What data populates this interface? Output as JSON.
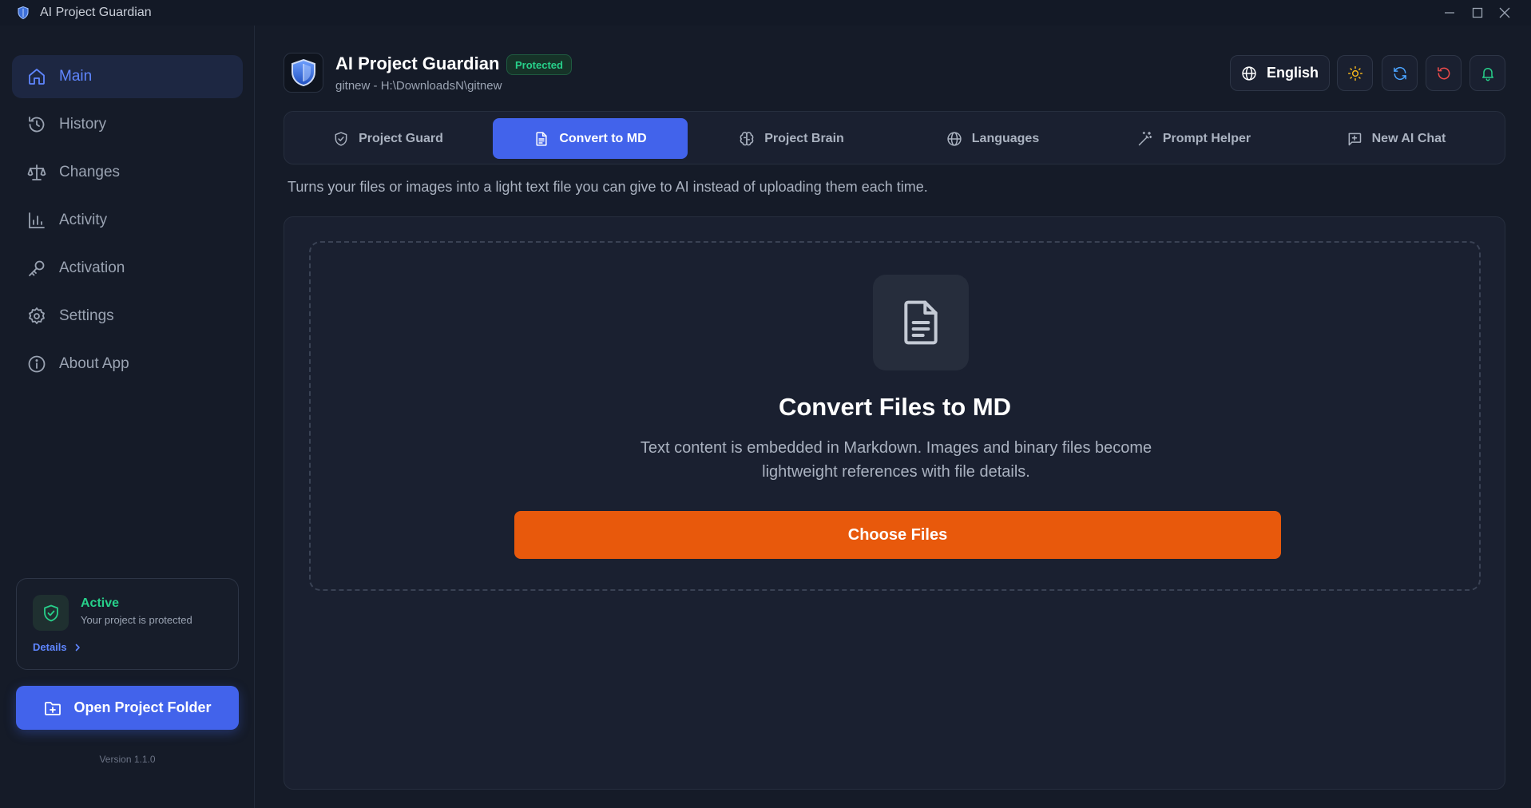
{
  "window": {
    "title": "AI Project Guardian",
    "controls": [
      "minimize-icon",
      "maximize-icon",
      "close-icon"
    ]
  },
  "sidebar": {
    "items": [
      {
        "label": "Main",
        "icon": "home-icon",
        "active": true
      },
      {
        "label": "History",
        "icon": "history-icon",
        "active": false
      },
      {
        "label": "Changes",
        "icon": "scale-icon",
        "active": false
      },
      {
        "label": "Activity",
        "icon": "bar-chart-icon",
        "active": false
      },
      {
        "label": "Activation",
        "icon": "key-icon",
        "active": false
      },
      {
        "label": "Settings",
        "icon": "gear-icon",
        "active": false
      },
      {
        "label": "About App",
        "icon": "info-icon",
        "active": false
      }
    ],
    "status_card": {
      "title": "Active",
      "subtitle": "Your project is protected",
      "details_label": "Details"
    },
    "open_folder_label": "Open Project Folder",
    "version": "Version 1.1.0"
  },
  "header": {
    "app_name": "AI Project Guardian",
    "badge": "Protected",
    "project_path": "gitnew - H:\\DownloadsN\\gitnew",
    "language_label": "English"
  },
  "tabs": [
    {
      "label": "Project Guard",
      "icon": "shield-icon",
      "active": false
    },
    {
      "label": "Convert to MD",
      "icon": "document-icon",
      "active": true
    },
    {
      "label": "Project Brain",
      "icon": "brain-icon",
      "active": false
    },
    {
      "label": "Languages",
      "icon": "globe-icon",
      "active": false
    },
    {
      "label": "Prompt Helper",
      "icon": "magic-wand-icon",
      "active": false
    },
    {
      "label": "New AI Chat",
      "icon": "chat-plus-icon",
      "active": false
    }
  ],
  "main": {
    "description": "Turns your files or images into a light text file you can give to AI instead of uploading them each time.",
    "dropzone": {
      "title": "Convert Files to MD",
      "description": "Text content is embedded in Markdown. Images and binary files become lightweight references with file details.",
      "button_label": "Choose Files"
    }
  },
  "colors": {
    "accent": "#4263eb",
    "active_nav_text": "#5f86ff",
    "success": "#27d08a",
    "primary_action": "#e8590c",
    "background": "#151b28",
    "panel": "#1a2030"
  }
}
